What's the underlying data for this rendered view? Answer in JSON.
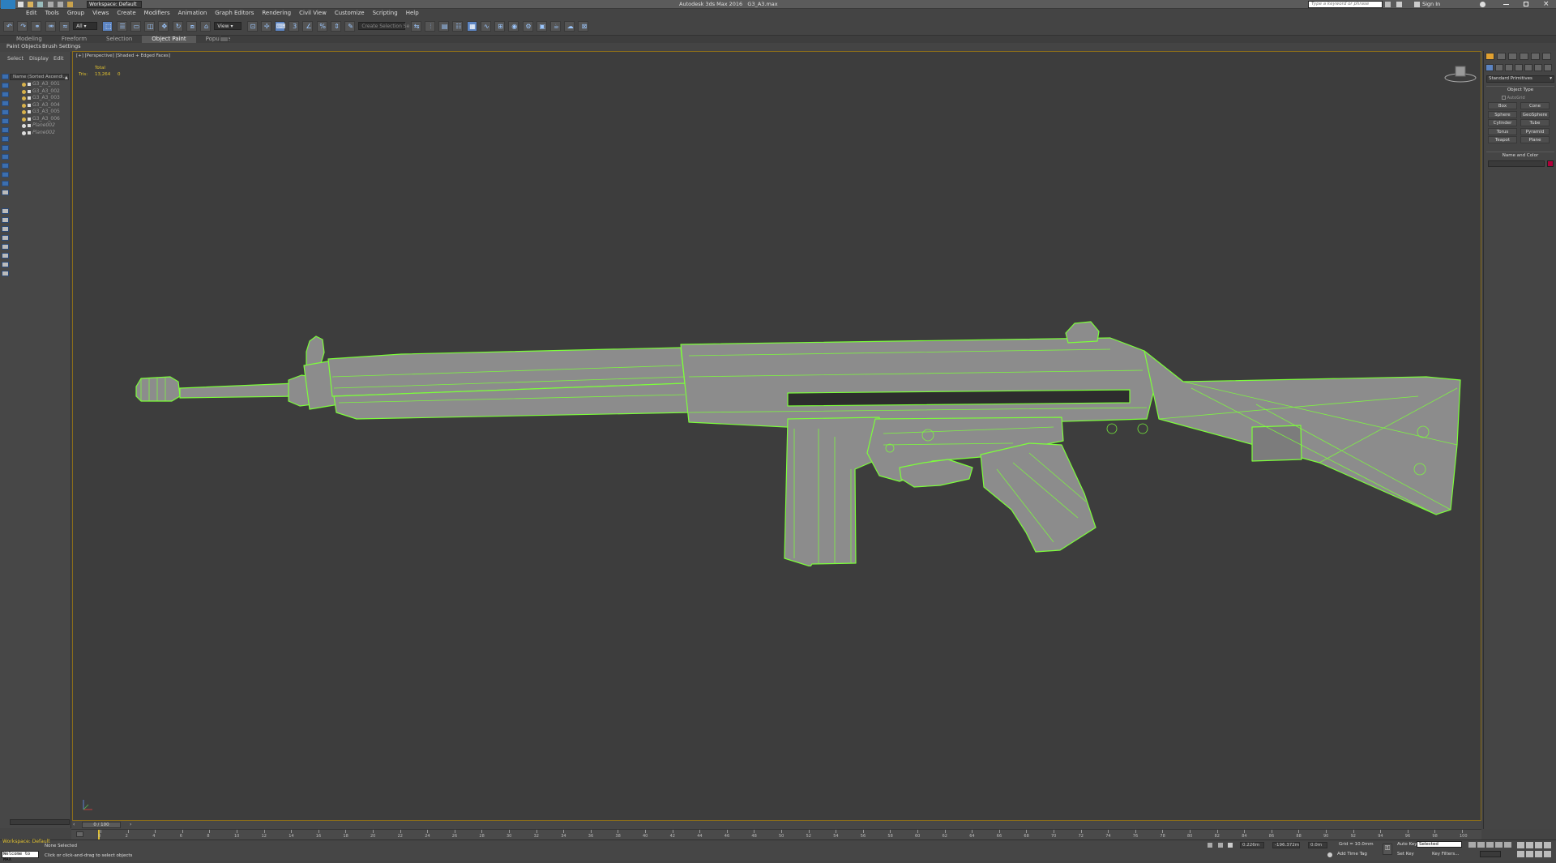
{
  "title_bar": {
    "workspace_label": "Workspace: Default",
    "app_title": "Autodesk 3ds Max 2016",
    "file_name": "G3_A3.max",
    "search_placeholder": "Type a keyword or phrase",
    "sign_in": "Sign In"
  },
  "menu": [
    "Edit",
    "Tools",
    "Group",
    "Views",
    "Create",
    "Modifiers",
    "Animation",
    "Graph Editors",
    "Rendering",
    "Civil View",
    "Customize",
    "Scripting",
    "Help"
  ],
  "toolbar": {
    "selection_filter": "All",
    "ref_coord": "View",
    "named_selection_placeholder": "Create Selection Se"
  },
  "ribbon": {
    "tabs": [
      "Modeling",
      "Freeform",
      "Selection",
      "Object Paint",
      "Populate"
    ],
    "active_tab": "Object Paint",
    "sub_items": [
      "Paint Objects",
      "Brush Settings"
    ]
  },
  "scene_explorer": {
    "menu": [
      "Select",
      "Display",
      "Edit"
    ],
    "column_header": "Name (Sorted Ascendi...",
    "rows": [
      {
        "name": "G3_A3_001",
        "visible": true
      },
      {
        "name": "G3_A3_002",
        "visible": true
      },
      {
        "name": "G3_A3_003",
        "visible": true
      },
      {
        "name": "G3_A3_004",
        "visible": true
      },
      {
        "name": "G3_A3_005",
        "visible": true
      },
      {
        "name": "G3_A3_006",
        "visible": true
      },
      {
        "name": "Plane002",
        "visible": false
      },
      {
        "name": "Plane002",
        "visible": false
      }
    ]
  },
  "viewport": {
    "label": "[+] [Perspective] [Shaded + Edged Faces]",
    "stats_header": "Total",
    "stats_label": "Tris:",
    "stats_total": "13,264",
    "stats_selected": "0",
    "wire_color": "#7cff3a",
    "mesh_color": "#8c8c8c"
  },
  "command_panel": {
    "category": "Standard Primitives",
    "object_type_header": "Object Type",
    "autogrid_label": "AutoGrid",
    "buttons": [
      "Box",
      "Cone",
      "Sphere",
      "GeoSphere",
      "Cylinder",
      "Tube",
      "Torus",
      "Pyramid",
      "Teapot",
      "Plane"
    ],
    "name_color_header": "Name and Color",
    "swatch_color": "#b0003a"
  },
  "timeline": {
    "frame_display": "0 / 100",
    "ticks": [
      "0",
      "2",
      "4",
      "6",
      "8",
      "10",
      "12",
      "14",
      "16",
      "18",
      "20",
      "22",
      "24",
      "26",
      "28",
      "30",
      "32",
      "34",
      "36",
      "38",
      "40",
      "42",
      "44",
      "46",
      "48",
      "50",
      "52",
      "54",
      "56",
      "58",
      "60",
      "62",
      "64",
      "66",
      "68",
      "70",
      "72",
      "74",
      "76",
      "78",
      "80",
      "82",
      "84",
      "86",
      "88",
      "90",
      "92",
      "94",
      "96",
      "98",
      "100"
    ]
  },
  "status": {
    "workspace_label": "Workspace: Default",
    "maxscript": "Welcome to MAX",
    "selection": "None Selected",
    "prompt": "Click or click-and-drag to select objects",
    "x_value": "0.226m",
    "y_value": "-196.372m",
    "z_value": "0.0m",
    "grid": "Grid = 10.0mm",
    "add_time_tag": "Add Time Tag",
    "auto_key": "Auto Key",
    "selected_dropdown": "Selected",
    "set_key": "Set Key",
    "key_filters": "Key Filters..."
  }
}
